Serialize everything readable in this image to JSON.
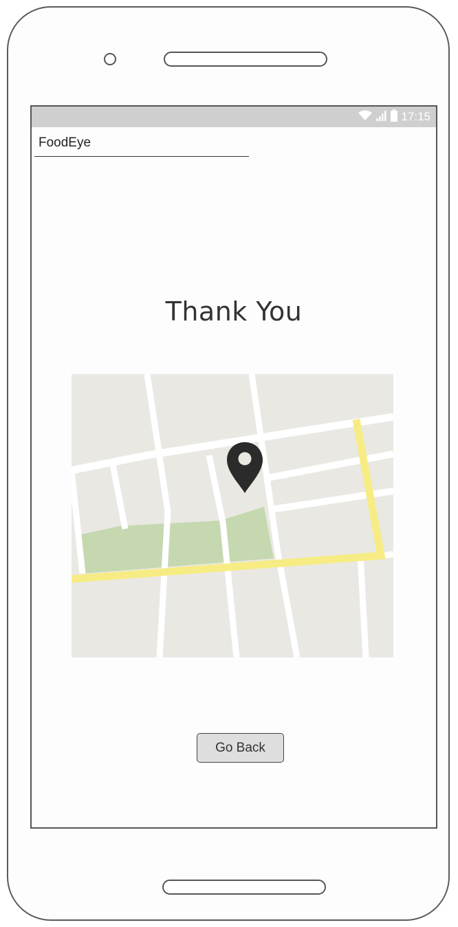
{
  "status_bar": {
    "time": "17:15",
    "icons": [
      "wifi-icon",
      "signal-icon",
      "battery-icon"
    ]
  },
  "app": {
    "title": "FoodEye"
  },
  "main": {
    "heading": "Thank You",
    "map": {
      "icon": "map-pin-icon",
      "colors": {
        "land": "#eae8e3",
        "park": "#c5d8b0",
        "highway": "#f7ec83",
        "street": "#ffffff",
        "pin": "#2b2b2b"
      }
    },
    "go_back_label": "Go Back"
  },
  "colors": {
    "status_bar": "#cfcfcf",
    "button_bg": "#dedede",
    "frame": "#555555"
  }
}
